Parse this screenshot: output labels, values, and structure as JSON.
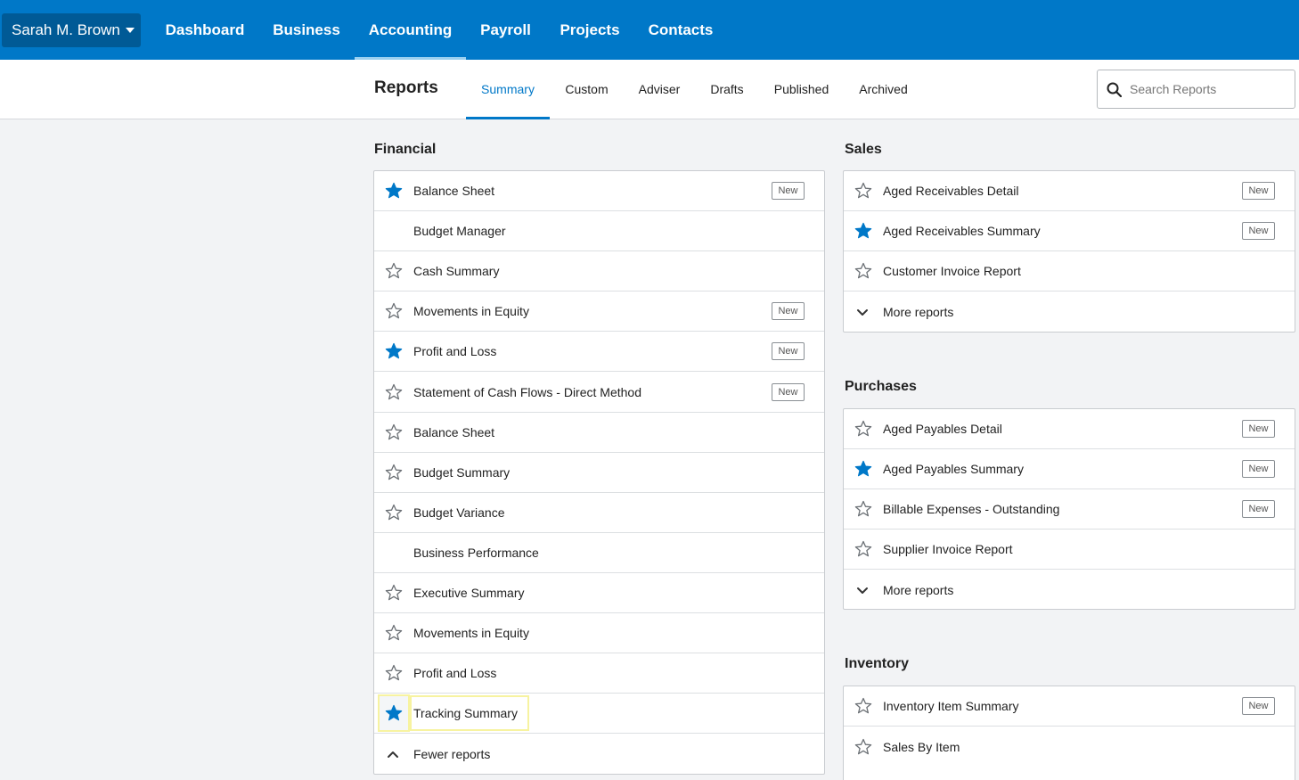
{
  "topnav": {
    "org_name": "Sarah M. Brown",
    "items": [
      {
        "label": "Dashboard"
      },
      {
        "label": "Business"
      },
      {
        "label": "Accounting"
      },
      {
        "label": "Payroll"
      },
      {
        "label": "Projects"
      },
      {
        "label": "Contacts"
      }
    ],
    "active_item": "Accounting"
  },
  "subheader": {
    "title": "Reports",
    "tabs": [
      {
        "label": "Summary"
      },
      {
        "label": "Custom"
      },
      {
        "label": "Adviser"
      },
      {
        "label": "Drafts"
      },
      {
        "label": "Published"
      },
      {
        "label": "Archived"
      }
    ],
    "active_tab": "Summary",
    "search_placeholder": "Search Reports"
  },
  "badge_text": "New",
  "colors": {
    "brand_blue": "#0078c8",
    "star_filled": "#0078c8",
    "highlight": "#f7f3a0"
  },
  "financial": {
    "title": "Financial",
    "rows": [
      {
        "label": "Balance Sheet",
        "star": "filled",
        "new": true
      },
      {
        "label": "Budget Manager",
        "star": "none",
        "new": false
      },
      {
        "label": "Cash Summary",
        "star": "outline",
        "new": false
      },
      {
        "label": "Movements in Equity",
        "star": "outline",
        "new": true
      },
      {
        "label": "Profit and Loss",
        "star": "filled",
        "new": true
      },
      {
        "label": "Statement of Cash Flows - Direct Method",
        "star": "outline",
        "new": true
      },
      {
        "label": "Balance Sheet",
        "star": "outline",
        "new": false
      },
      {
        "label": "Budget Summary",
        "star": "outline",
        "new": false
      },
      {
        "label": "Budget Variance",
        "star": "outline",
        "new": false
      },
      {
        "label": "Business Performance",
        "star": "none",
        "new": false
      },
      {
        "label": "Executive Summary",
        "star": "outline",
        "new": false
      },
      {
        "label": "Movements in Equity",
        "star": "outline",
        "new": false
      },
      {
        "label": "Profit and Loss",
        "star": "outline",
        "new": false
      },
      {
        "label": "Tracking Summary",
        "star": "filled",
        "new": false,
        "highlighted": true
      }
    ],
    "toggle_label": "Fewer reports"
  },
  "sales": {
    "title": "Sales",
    "rows": [
      {
        "label": "Aged Receivables Detail",
        "star": "outline",
        "new": true
      },
      {
        "label": "Aged Receivables Summary",
        "star": "filled",
        "new": true
      },
      {
        "label": "Customer Invoice Report",
        "star": "outline",
        "new": false
      }
    ],
    "toggle_label": "More reports"
  },
  "purchases": {
    "title": "Purchases",
    "rows": [
      {
        "label": "Aged Payables Detail",
        "star": "outline",
        "new": true
      },
      {
        "label": "Aged Payables Summary",
        "star": "filled",
        "new": true
      },
      {
        "label": "Billable Expenses - Outstanding",
        "star": "outline",
        "new": true
      },
      {
        "label": "Supplier Invoice Report",
        "star": "outline",
        "new": false
      }
    ],
    "toggle_label": "More reports"
  },
  "inventory": {
    "title": "Inventory",
    "rows": [
      {
        "label": "Inventory Item Summary",
        "star": "outline",
        "new": true
      },
      {
        "label": "Sales By Item",
        "star": "outline",
        "new": false
      }
    ]
  }
}
